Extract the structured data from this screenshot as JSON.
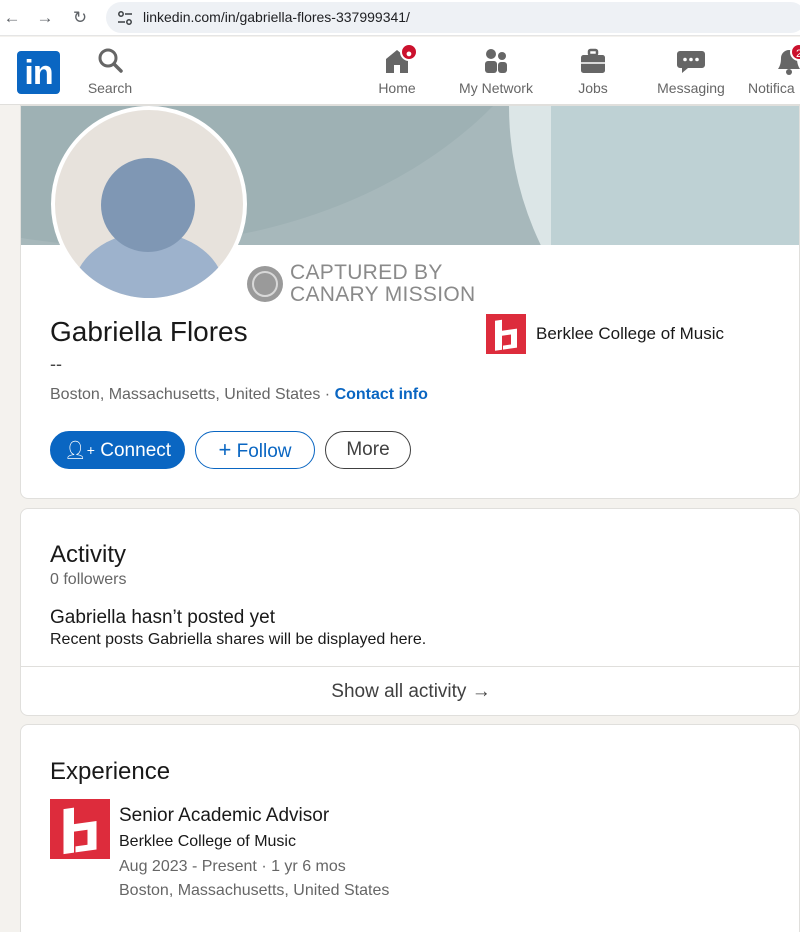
{
  "browser": {
    "url": "linkedin.com/in/gabriella-flores-337999341/"
  },
  "nav": {
    "logo": "in",
    "items": [
      {
        "label": "Search",
        "icon": "search-icon"
      },
      {
        "label": "Home",
        "icon": "home-icon",
        "badge": ""
      },
      {
        "label": "My Network",
        "icon": "network-icon"
      },
      {
        "label": "Jobs",
        "icon": "briefcase-icon"
      },
      {
        "label": "Messaging",
        "icon": "messaging-icon"
      },
      {
        "label": "Notifica",
        "icon": "bell-icon",
        "badge": "2"
      }
    ]
  },
  "profile": {
    "watermark_line1": "CAPTURED BY",
    "watermark_line2": "CANARY MISSION",
    "name": "Gabriella Flores",
    "headline": "--",
    "location": "Boston, Massachusetts, United States",
    "separator": " · ",
    "contact_info": "Contact info",
    "education": "Berklee College of Music",
    "connect_label": "Connect",
    "follow_label": "Follow",
    "more_label": "More"
  },
  "activity": {
    "title": "Activity",
    "followers": "0 followers",
    "empty_title": "Gabriella hasn’t posted yet",
    "empty_sub": "Recent posts Gabriella shares will be displayed here.",
    "show_all": "Show all activity →"
  },
  "experience": {
    "title": "Experience",
    "items": [
      {
        "role": "Senior Academic Advisor",
        "company": "Berklee College of Music",
        "dates": "Aug 2023 - Present · 1 yr 6 mos",
        "location": "Boston, Massachusetts, United States"
      }
    ]
  },
  "colors": {
    "brand_blue": "#0a66c2",
    "berklee_red": "#dd2c3c",
    "badge_red": "#cb112d"
  }
}
